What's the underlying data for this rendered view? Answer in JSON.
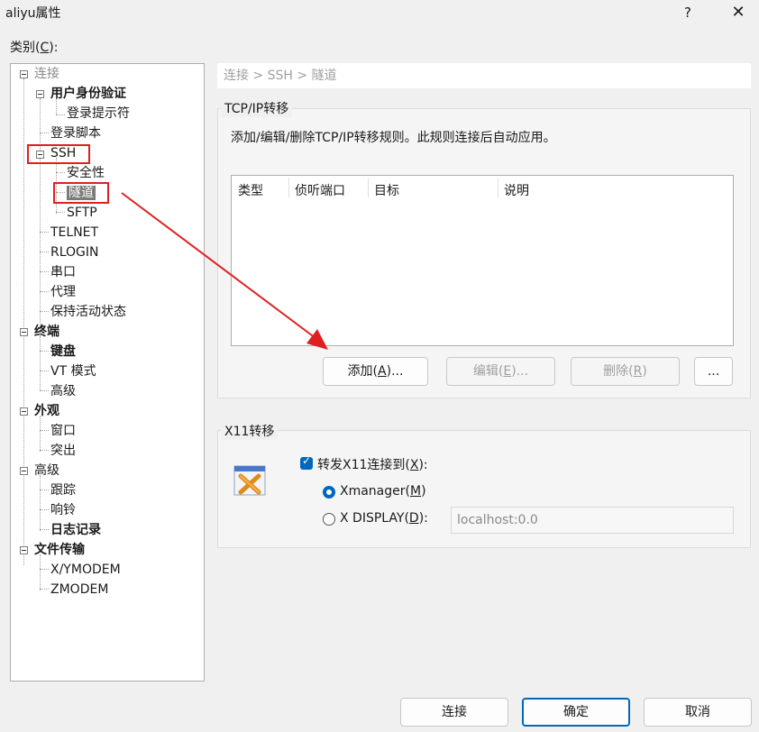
{
  "window": {
    "title": "aliyu属性",
    "help_glyph": "?",
    "close_glyph": "✕"
  },
  "category_label": {
    "prefix": "类别(",
    "mnemonic": "C",
    "suffix": "):"
  },
  "tree": {
    "connection": "连接",
    "user_auth": "用户身份验证",
    "login_prompt": "登录提示符",
    "login_script": "登录脚本",
    "ssh": "SSH",
    "security": "安全性",
    "tunnel": "隧道",
    "sftp": "SFTP",
    "telnet": "TELNET",
    "rlogin": "RLOGIN",
    "serial": "串口",
    "proxy": "代理",
    "keepalive": "保持活动状态",
    "terminal": "终端",
    "keyboard": "键盘",
    "vt_mode": "VT 模式",
    "advanced_term": "高级",
    "appearance": "外观",
    "window": "窗口",
    "highlight": "突出",
    "advanced": "高级",
    "trace": "跟踪",
    "bell": "响铃",
    "logging": "日志记录",
    "file_transfer": "文件传输",
    "xymodem": "X/YMODEM",
    "zmodem": "ZMODEM"
  },
  "breadcrumb": "连接 > SSH > 隧道",
  "tcp": {
    "title": "TCP/IP转移",
    "description": "添加/编辑/删除TCP/IP转移规则。此规则连接后自动应用。",
    "columns": [
      "类型",
      "侦听端口",
      "目标",
      "说明"
    ],
    "add": {
      "prefix": "添加(",
      "mnemonic": "A",
      "suffix": ")..."
    },
    "edit": {
      "prefix": "编辑(",
      "mnemonic": "E",
      "suffix": ")..."
    },
    "delete": {
      "prefix": "删除(",
      "mnemonic": "R",
      "suffix": ")"
    },
    "more": "..."
  },
  "x11": {
    "title": "X11转移",
    "forward": {
      "prefix": "转发X11连接到(",
      "mnemonic": "X",
      "suffix": "):",
      "checked": true
    },
    "xmanager": {
      "prefix": "Xmanager(",
      "mnemonic": "M",
      "suffix": ")",
      "selected": true
    },
    "xdisplay": {
      "prefix": "X DISPLAY(",
      "mnemonic": "D",
      "suffix": "):",
      "selected": false
    },
    "display_value": "localhost:0.0"
  },
  "footer": {
    "connect": "连接",
    "ok": "确定",
    "cancel": "取消"
  },
  "colors": {
    "accent": "#0067c0",
    "annotation": "#e02020"
  }
}
